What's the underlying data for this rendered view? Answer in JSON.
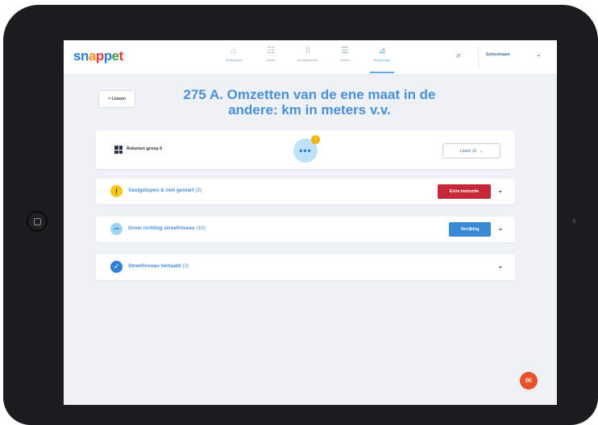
{
  "app": {
    "logo": [
      "sn",
      "a",
      "p",
      "p",
      "e",
      "t"
    ]
  },
  "nav": {
    "items": [
      {
        "label": "Startpagina",
        "icon": "home-icon",
        "glyph": "⌂"
      },
      {
        "label": "Lessen",
        "icon": "list-icon",
        "glyph": "☷"
      },
      {
        "label": "Werkpakketten",
        "icon": "dots-grid-icon",
        "glyph": "⁞⁞"
      },
      {
        "label": "Doelen",
        "icon": "target-list-icon",
        "glyph": "☰"
      },
      {
        "label": "Rapportage",
        "icon": "chart-icon",
        "glyph": "⊿"
      }
    ],
    "active_index": 4
  },
  "header": {
    "user_name": "Schoolnaam",
    "search_icon": "search-icon"
  },
  "page": {
    "back_label": "< Lessen",
    "title": "275 A. Omzetten van de ene maat in de andere: km in meters v.v."
  },
  "group_card": {
    "group_label": "Rekenen groep 6",
    "dots": "•••",
    "badge": "!",
    "les_select": "Lesen 15"
  },
  "rows": [
    {
      "label": "Vastgelopen & niet gestart",
      "count": "(2)",
      "button": "Extra instructie",
      "icon": "warning-icon"
    },
    {
      "label": "Groei richting streefniveau",
      "count": "(16)",
      "button": "Verrijking",
      "icon": "growth-icon"
    },
    {
      "label": "Streefniveau behaald",
      "count": "(3)",
      "button": "",
      "icon": "check-icon"
    }
  ],
  "colors": {
    "accent": "#4a90d9",
    "danger": "#c62839",
    "primary_button": "#3a8ad6",
    "warning": "#f7c515",
    "fab": "#e8542a"
  }
}
